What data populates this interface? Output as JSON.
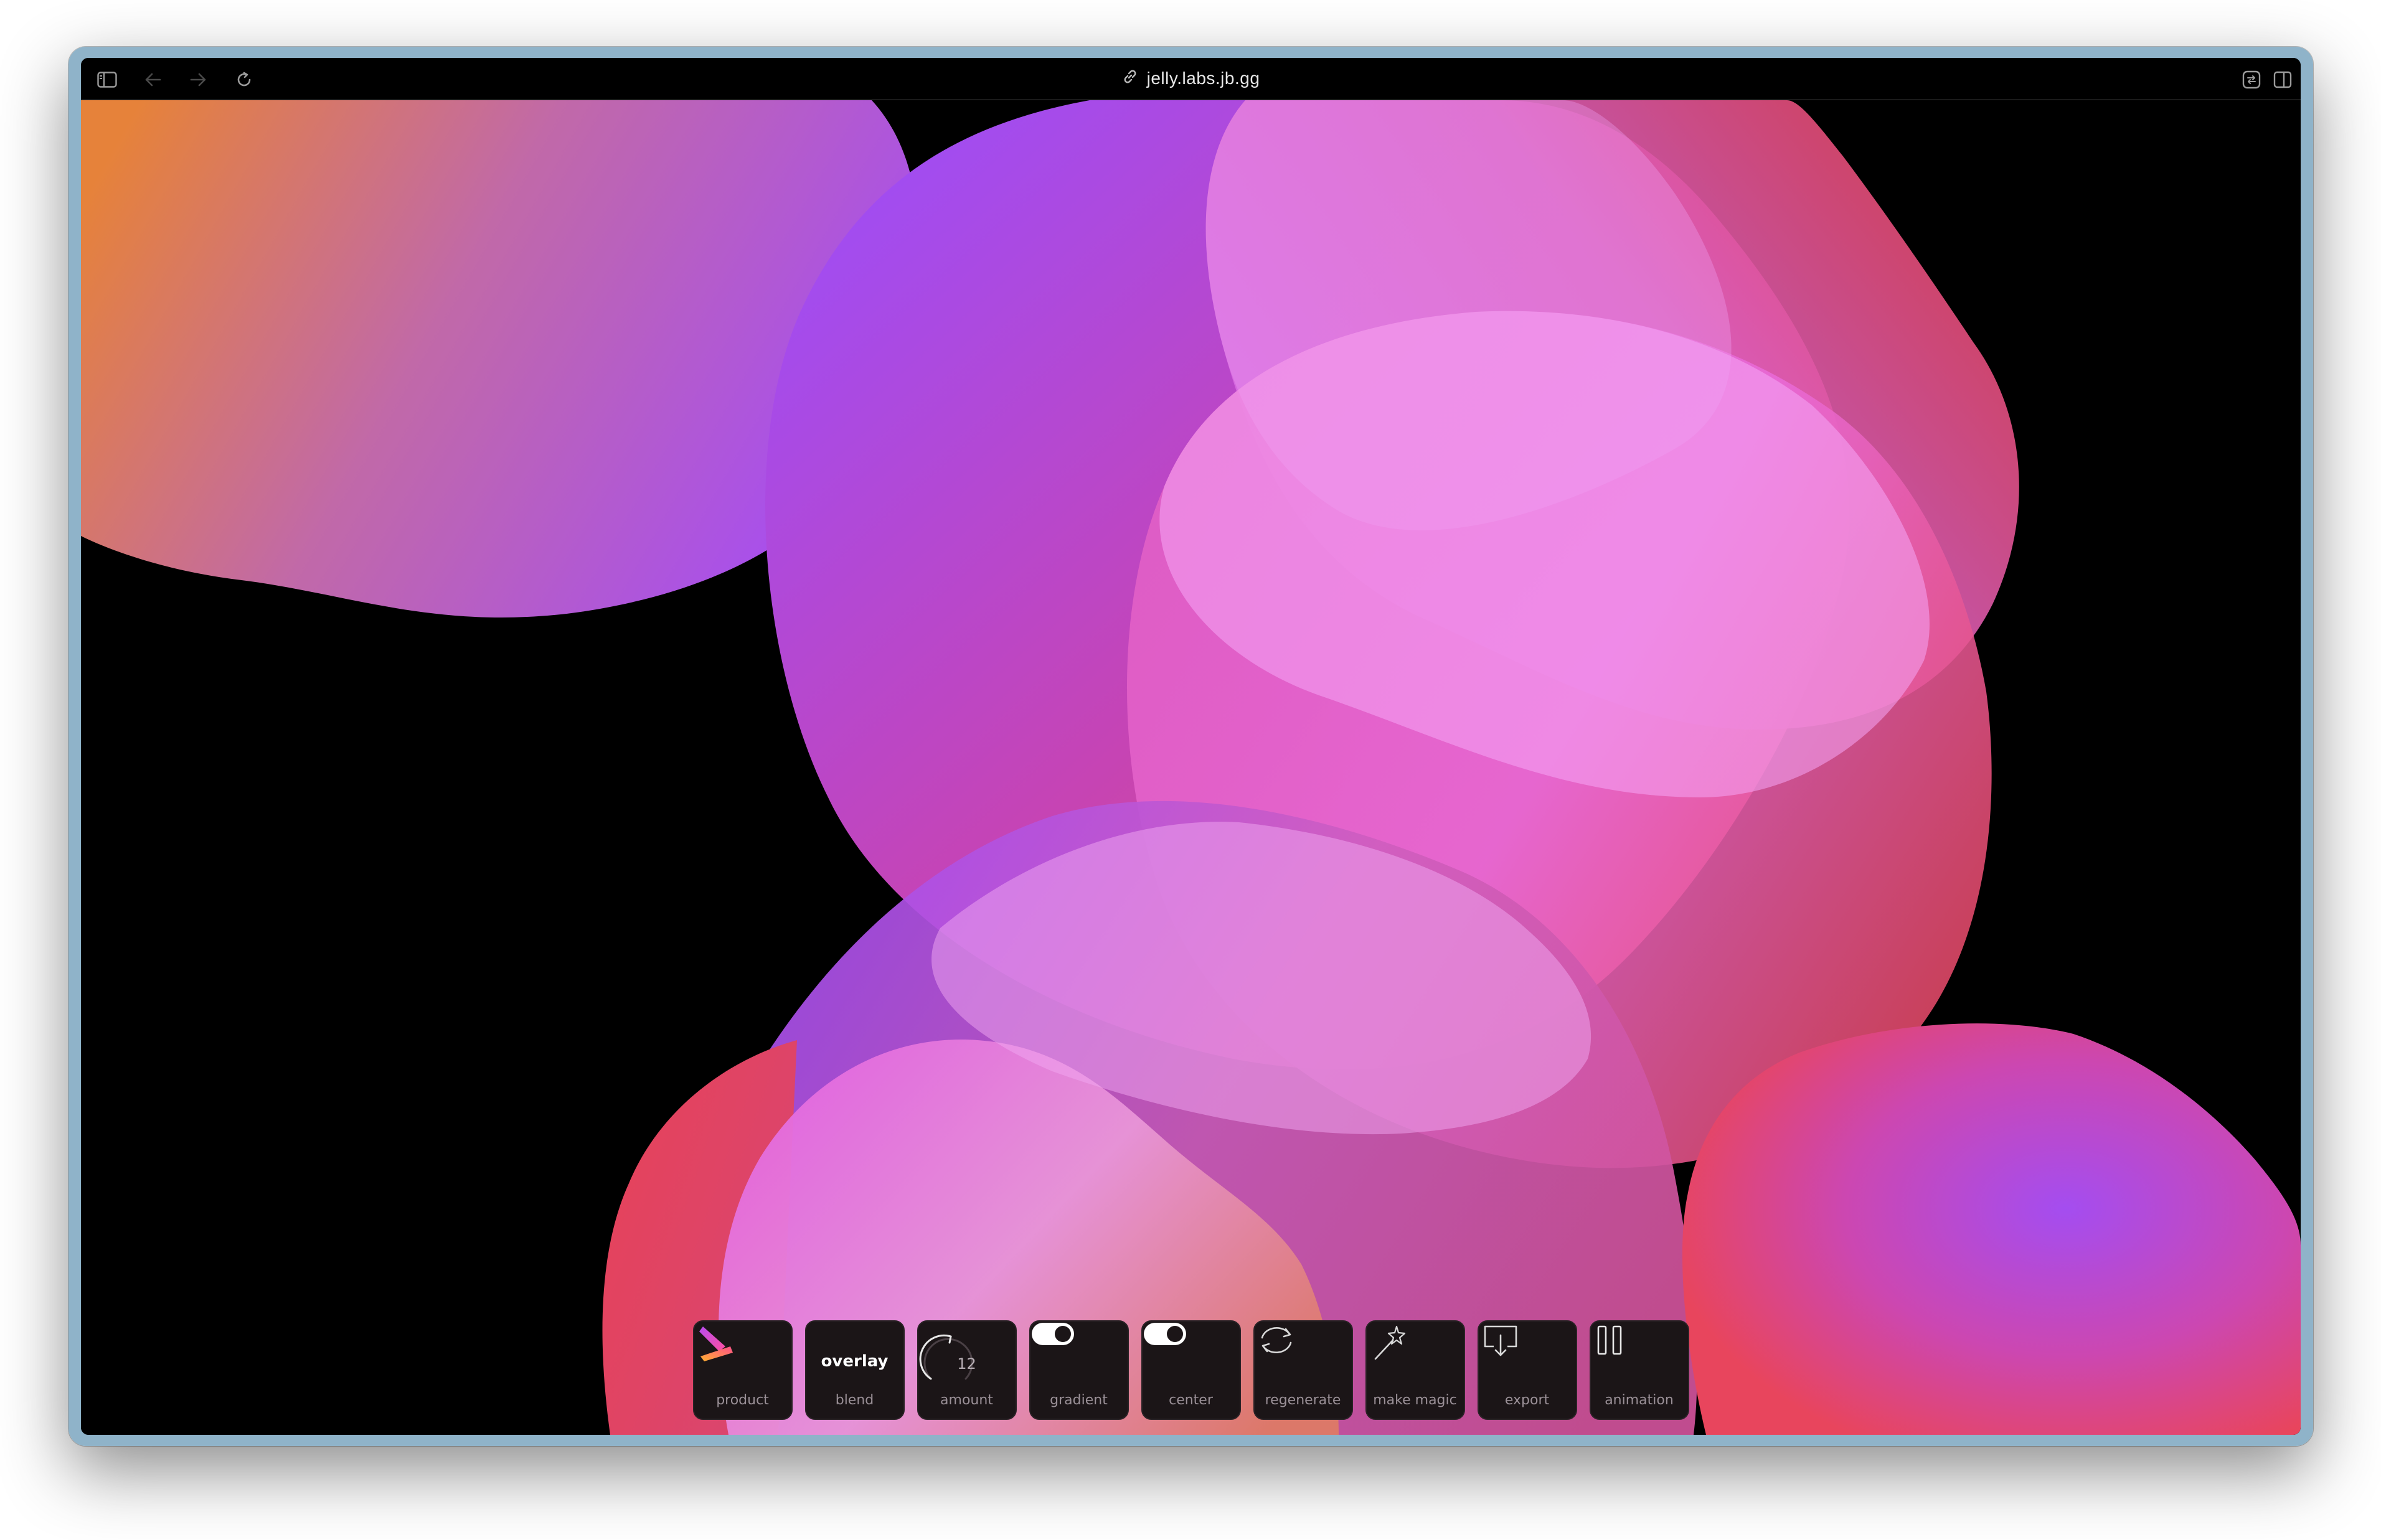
{
  "browser": {
    "url": "jelly.labs.jb.gg",
    "icons": {
      "sidebar": "sidebar-icon",
      "back": "arrow-left-icon",
      "forward": "arrow-right-icon",
      "reload": "reload-icon",
      "link": "link-icon",
      "translate": "page-menu-icon",
      "split": "split-view-icon"
    }
  },
  "colors": {
    "orange": "#e67e3a",
    "purple": "#a54cf0",
    "pink": "#e86ad8",
    "red": "#e8435c",
    "background": "#000000",
    "dock_bg": "#1b1517"
  },
  "dock": {
    "product": {
      "label": "product",
      "icon": "jetbrains-product-icon"
    },
    "blend": {
      "label": "blend",
      "value": "overlay"
    },
    "amount": {
      "label": "amount",
      "value": "12"
    },
    "gradient": {
      "label": "gradient",
      "icon": "toggle-on-icon",
      "enabled": true
    },
    "center": {
      "label": "center",
      "icon": "toggle-on-icon",
      "enabled": true
    },
    "regenerate": {
      "label": "regenerate",
      "icon": "refresh-icon"
    },
    "make_magic": {
      "label": "make magic",
      "icon": "magic-wand-icon"
    },
    "export": {
      "label": "export",
      "icon": "export-icon"
    },
    "animation": {
      "label": "animation",
      "icon": "pause-icon"
    }
  }
}
